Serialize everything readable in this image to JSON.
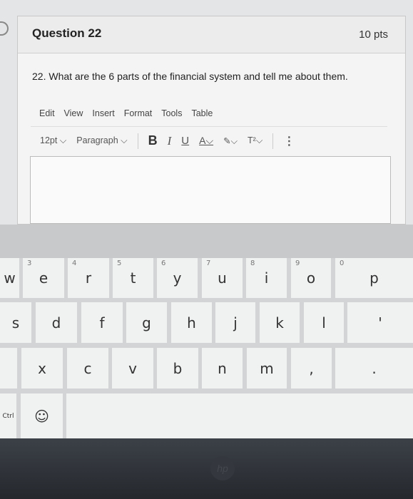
{
  "question": {
    "title": "Question 22",
    "points": "10 pts",
    "text": "22. What are the 6 parts of the financial system and tell me about them."
  },
  "editor": {
    "menu": [
      "Edit",
      "View",
      "Insert",
      "Format",
      "Tools",
      "Table"
    ],
    "font_size": "12pt ⌵",
    "block_format": "Paragraph ⌵",
    "bold": "B",
    "italic": "I",
    "underline": "U",
    "text_color": "A⌵",
    "highlight": "✎⌵",
    "superscript": "T²⌵",
    "more": "⋮",
    "value": ""
  },
  "keyboard": {
    "row1": [
      {
        "k": "w",
        "n": ""
      },
      {
        "k": "e",
        "n": "3"
      },
      {
        "k": "r",
        "n": "4"
      },
      {
        "k": "t",
        "n": "5"
      },
      {
        "k": "y",
        "n": "6"
      },
      {
        "k": "u",
        "n": "7"
      },
      {
        "k": "i",
        "n": "8"
      },
      {
        "k": "o",
        "n": "9"
      },
      {
        "k": "p",
        "n": "0"
      }
    ],
    "row2": [
      "s",
      "d",
      "f",
      "g",
      "h",
      "j",
      "k",
      "l",
      "'"
    ],
    "row3": [
      "",
      "x",
      "c",
      "v",
      "b",
      "n",
      "m",
      ",",
      "."
    ],
    "row4": [
      "Ctrl",
      "☺",
      ""
    ]
  },
  "logo": "hp"
}
